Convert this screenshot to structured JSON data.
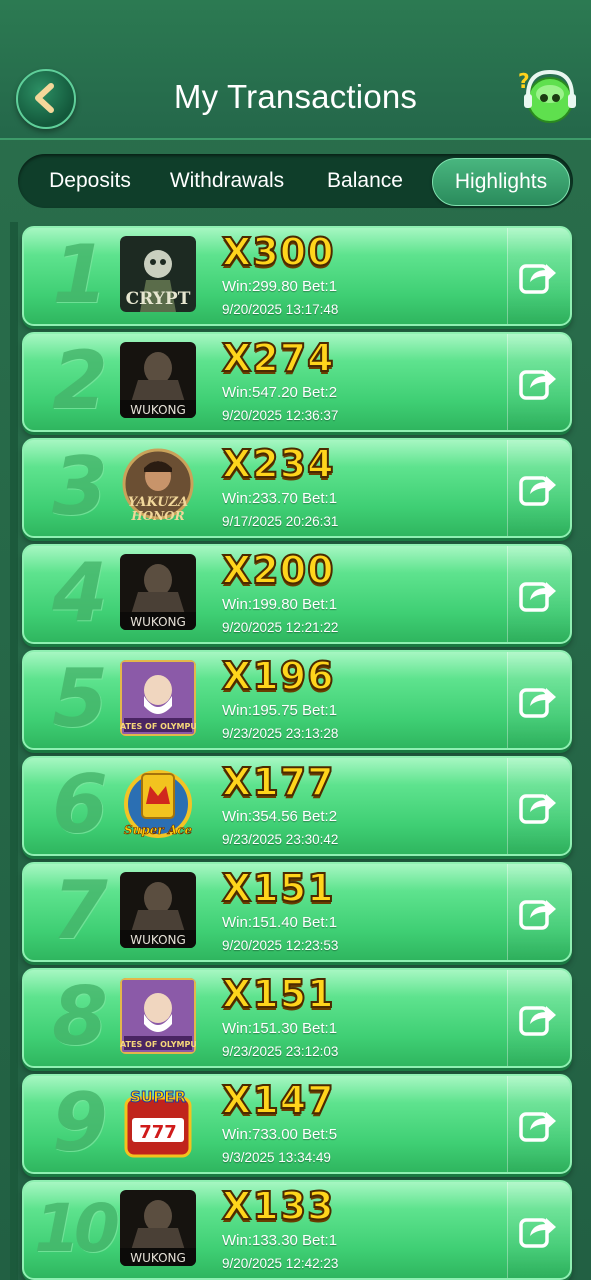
{
  "header": {
    "title": "My Transactions"
  },
  "tabs": [
    {
      "label": "Deposits",
      "active": false
    },
    {
      "label": "Withdrawals",
      "active": false
    },
    {
      "label": "Balance",
      "active": false
    },
    {
      "label": "Highlights",
      "active": true
    }
  ],
  "highlights": [
    {
      "rank": "1",
      "game": "THE CRYPT",
      "multiplier": "X300",
      "win_bet": "Win:299.80 Bet:1",
      "date": "9/20/2025 13:17:48"
    },
    {
      "rank": "2",
      "game": "WUKONG",
      "multiplier": "X274",
      "win_bet": "Win:547.20 Bet:2",
      "date": "9/20/2025 12:36:37"
    },
    {
      "rank": "3",
      "game": "YAKUZA HONOR",
      "multiplier": "X234",
      "win_bet": "Win:233.70 Bet:1",
      "date": "9/17/2025 20:26:31"
    },
    {
      "rank": "4",
      "game": "WUKONG",
      "multiplier": "X200",
      "win_bet": "Win:199.80 Bet:1",
      "date": "9/20/2025 12:21:22"
    },
    {
      "rank": "5",
      "game": "GATES OF OLYMPUS",
      "multiplier": "X196",
      "win_bet": "Win:195.75 Bet:1",
      "date": "9/23/2025 23:13:28"
    },
    {
      "rank": "6",
      "game": "SUPER ACE",
      "multiplier": "X177",
      "win_bet": "Win:354.56 Bet:2",
      "date": "9/23/2025 23:30:42"
    },
    {
      "rank": "7",
      "game": "WUKONG",
      "multiplier": "X151",
      "win_bet": "Win:151.40 Bet:1",
      "date": "9/20/2025 12:23:53"
    },
    {
      "rank": "8",
      "game": "GATES OF OLYMPUS",
      "multiplier": "X151",
      "win_bet": "Win:151.30 Bet:1",
      "date": "9/23/2025 23:12:03"
    },
    {
      "rank": "9",
      "game": "SUPER 777",
      "multiplier": "X147",
      "win_bet": "Win:733.00 Bet:5",
      "date": "9/3/2025 13:34:49"
    },
    {
      "rank": "10",
      "game": "WUKONG",
      "multiplier": "X133",
      "win_bet": "Win:133.30 Bet:1",
      "date": "9/20/2025 12:42:23"
    }
  ],
  "icons": {
    "back": "chevron-left-icon",
    "support": "support-agent-icon",
    "share": "share-arrow-icon"
  }
}
